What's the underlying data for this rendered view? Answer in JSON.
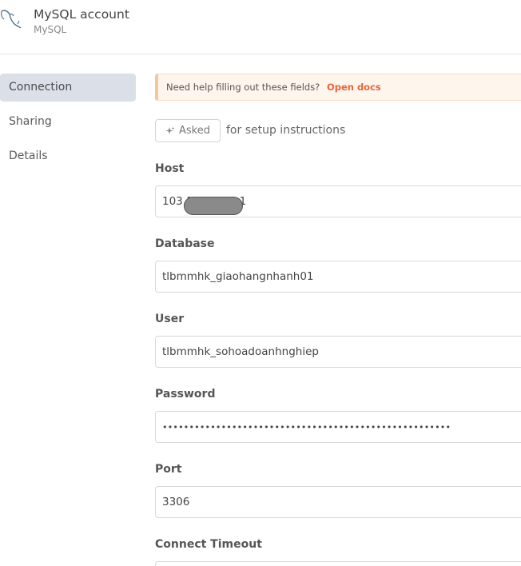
{
  "header": {
    "title": "MySQL account",
    "subtitle": "MySQL",
    "logo_icon": "mysql-dolphin-icon"
  },
  "sidebar": {
    "items": [
      {
        "label": "Connection",
        "active": true
      },
      {
        "label": "Sharing",
        "active": false
      },
      {
        "label": "Details",
        "active": false
      }
    ]
  },
  "notice": {
    "text": "Need help filling out these fields?",
    "link": "Open docs"
  },
  "ask": {
    "button_label": "Asked",
    "note": "for setup instructions",
    "icon": "sparkle-icon"
  },
  "fields": {
    "host": {
      "label": "Host",
      "value_start": "103.1",
      "value_end": "1"
    },
    "database": {
      "label": "Database",
      "value": "tlbmmhk_giaohangnhanh01"
    },
    "user": {
      "label": "User",
      "value": "tlbmmhk_sohoadoanhnghiep"
    },
    "password": {
      "label": "Password",
      "value": "••••••••••••••••••••••••••••••••••••••••••••••••••••••"
    },
    "port": {
      "label": "Port",
      "value": "3306"
    },
    "connect_timeout": {
      "label": "Connect Timeout",
      "value": ""
    }
  },
  "colors": {
    "accent": "#e8643c",
    "active_bg": "#dbdfe8",
    "notice_bg": "#fef5ec"
  }
}
